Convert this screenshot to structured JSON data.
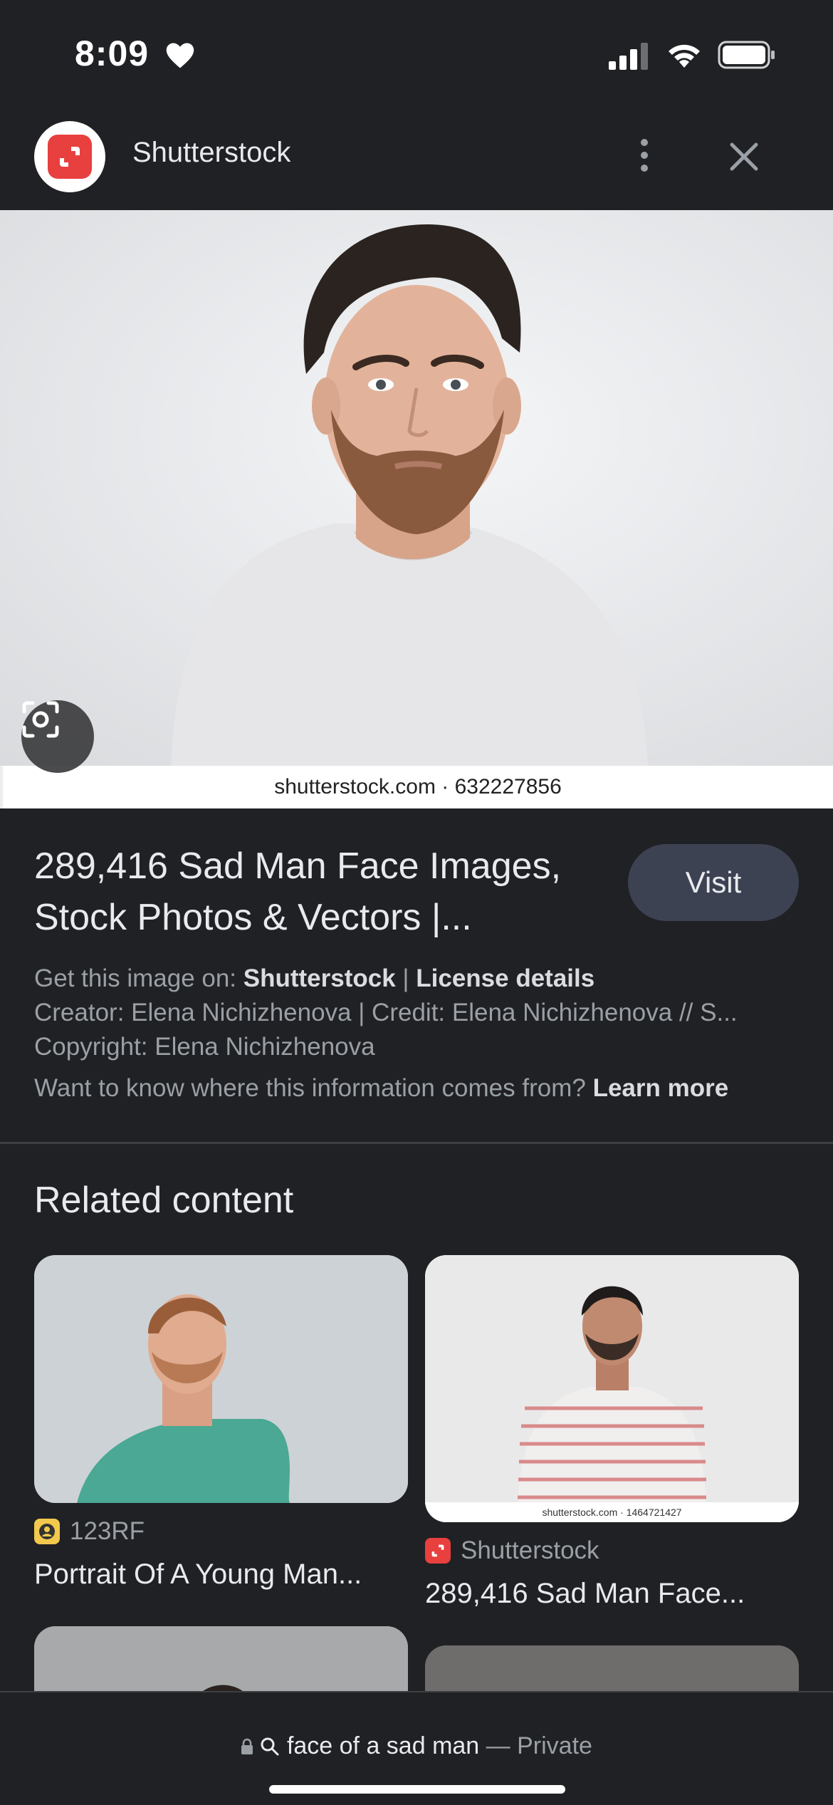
{
  "status_bar": {
    "time": "8:09"
  },
  "header": {
    "site_name": "Shutterstock"
  },
  "hero": {
    "watermark": "shutterstock.com · 632227856"
  },
  "result": {
    "title": "289,416 Sad Man Face Images, Stock Photos & Vectors |...",
    "visit_label": "Visit",
    "get_image_prefix": "Get this image on: ",
    "get_image_source": "Shutterstock",
    "separator": " | ",
    "license_details": "License details",
    "creator_line": "Creator: Elena Nichizhenova | Credit: Elena Nichizhenova // S...",
    "copyright_line": "Copyright: Elena Nichizhenova",
    "info_question": "Want to know where this information comes from? ",
    "learn_more": "Learn more"
  },
  "related": {
    "heading": "Related content",
    "cards": [
      {
        "source": "123RF",
        "title": "Portrait Of A Young Man...",
        "favicon": "123rf-icon"
      },
      {
        "source": "Shutterstock",
        "title": "289,416 Sad Man Face...",
        "favicon": "shutterstock-icon",
        "watermark": "shutterstock.com · 1464721427"
      }
    ]
  },
  "bottom_bar": {
    "query": "face of a sad man",
    "dash": " — ",
    "mode": "Private"
  },
  "colors": {
    "background": "#202124",
    "visit_button": "#3c4252",
    "brand_red": "#e8403f"
  }
}
